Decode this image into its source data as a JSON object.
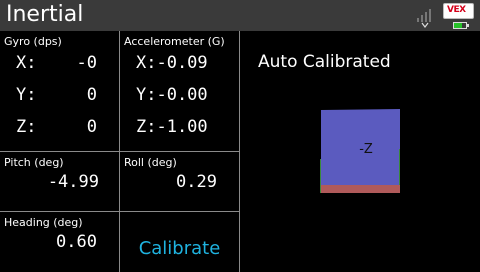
{
  "header": {
    "title": "Inertial"
  },
  "gyro": {
    "label": "Gyro (dps)",
    "x_label": "X:",
    "x_value": "-0",
    "y_label": "Y:",
    "y_value": "0",
    "z_label": "Z:",
    "z_value": "0"
  },
  "accel": {
    "label": "Accelerometer (G)",
    "x": "X:-0.09",
    "y": "Y:-0.00",
    "z": "Z:-1.00"
  },
  "pitch": {
    "label": "Pitch (deg)",
    "value": "-4.99"
  },
  "roll": {
    "label": "Roll (deg)",
    "value": "0.29"
  },
  "heading": {
    "label": "Heading (deg)",
    "value": "0.60"
  },
  "calibrate": {
    "label": "Calibrate"
  },
  "status": {
    "text": "Auto Calibrated"
  },
  "cube": {
    "face_label": "-Z",
    "face_color": "#5b5bbf",
    "edge_color": "#b05a5a",
    "side_color": "#3a8a3a"
  },
  "battery": {
    "level_fraction": 0.7,
    "color": "#27c22a"
  },
  "logo": {
    "text": "VEX"
  },
  "icons": {
    "signal": "signal-strength-icon",
    "battery": "battery-icon",
    "logo": "vex-logo-icon"
  }
}
